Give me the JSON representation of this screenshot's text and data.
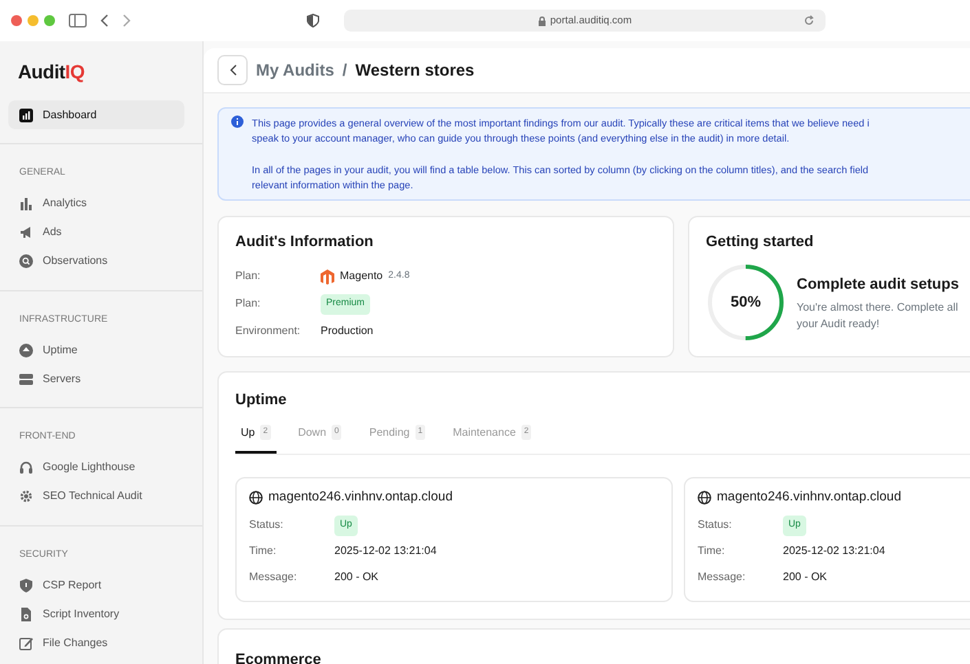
{
  "browser": {
    "url": "portal.auditiq.com"
  },
  "sidebar": {
    "logo": {
      "main": "Audit",
      "accent": "IQ"
    },
    "sections": [
      {
        "items": [
          {
            "label": "Dashboard",
            "selected": true
          }
        ]
      },
      {
        "heading": "GENERAL",
        "items": [
          {
            "label": "Analytics",
            "selected": false
          },
          {
            "label": "Ads",
            "selected": false
          },
          {
            "label": "Observations",
            "selected": false
          }
        ]
      },
      {
        "heading": "INFRASTRUCTURE",
        "items": [
          {
            "label": "Uptime",
            "selected": false
          },
          {
            "label": "Servers",
            "selected": false
          }
        ]
      },
      {
        "heading": "FRONT-END",
        "items": [
          {
            "label": "Google Lighthouse",
            "selected": false
          },
          {
            "label": "SEO Technical Audit",
            "selected": false
          }
        ]
      },
      {
        "heading": "SECURITY",
        "items": [
          {
            "label": "CSP Report",
            "selected": false
          },
          {
            "label": "Script Inventory",
            "selected": false
          },
          {
            "label": "File Changes",
            "selected": false
          }
        ]
      }
    ]
  },
  "header": {
    "breadcrumb_parent": "My Audits",
    "separator": "/",
    "title": "Western stores"
  },
  "info_alert": {
    "paragraphs": [
      "This page provides a general overview of the most important findings from our audit. Typically these are critical items that we believe need i",
      "speak to your account manager, who can guide you through these points (and everything else in the audit) in more detail.",
      "In all of the pages in your audit, you will find a table below. This can sorted by column (by clicking on the column titles), and the search field",
      "relevant information within the page."
    ]
  },
  "audit_info": {
    "title": "Audit's Information",
    "rows": [
      {
        "label": "Plan:",
        "kind": "platform",
        "value": "Magento",
        "version": "2.4.8"
      },
      {
        "label": "Plan:",
        "kind": "badge",
        "value": "Premium"
      },
      {
        "label": "Environment:",
        "kind": "text",
        "value": "Production"
      }
    ]
  },
  "getting_started": {
    "title": "Getting started",
    "level": 0.5,
    "percent": "50%",
    "heading": "Complete audit setups",
    "text_lines": [
      "You're almost there. Complete all",
      "your Audit ready!"
    ]
  },
  "uptime": {
    "title": "Uptime",
    "tabs": [
      {
        "label": "Up",
        "count": "2",
        "selected": true
      },
      {
        "label": "Down",
        "count": "0",
        "selected": false
      },
      {
        "label": "Pending",
        "count": "1",
        "selected": false
      },
      {
        "label": "Maintenance",
        "count": "2",
        "selected": false
      }
    ],
    "monitors": [
      {
        "host": "magento246.vinhnv.ontap.cloud",
        "status_label": "Status:",
        "status": "Up",
        "time_label": "Time:",
        "time": "2025-12-02 13:21:04",
        "message_label": "Message:",
        "message": "200 - OK"
      },
      {
        "host": "magento246.vinhnv.ontap.cloud",
        "status_label": "Status:",
        "status": "Up",
        "time_label": "Time:",
        "time": "2025-12-02 13:21:04",
        "message_label": "Message:",
        "message": "200 - OK"
      }
    ]
  },
  "ecommerce": {
    "title": "Ecommerce"
  }
}
